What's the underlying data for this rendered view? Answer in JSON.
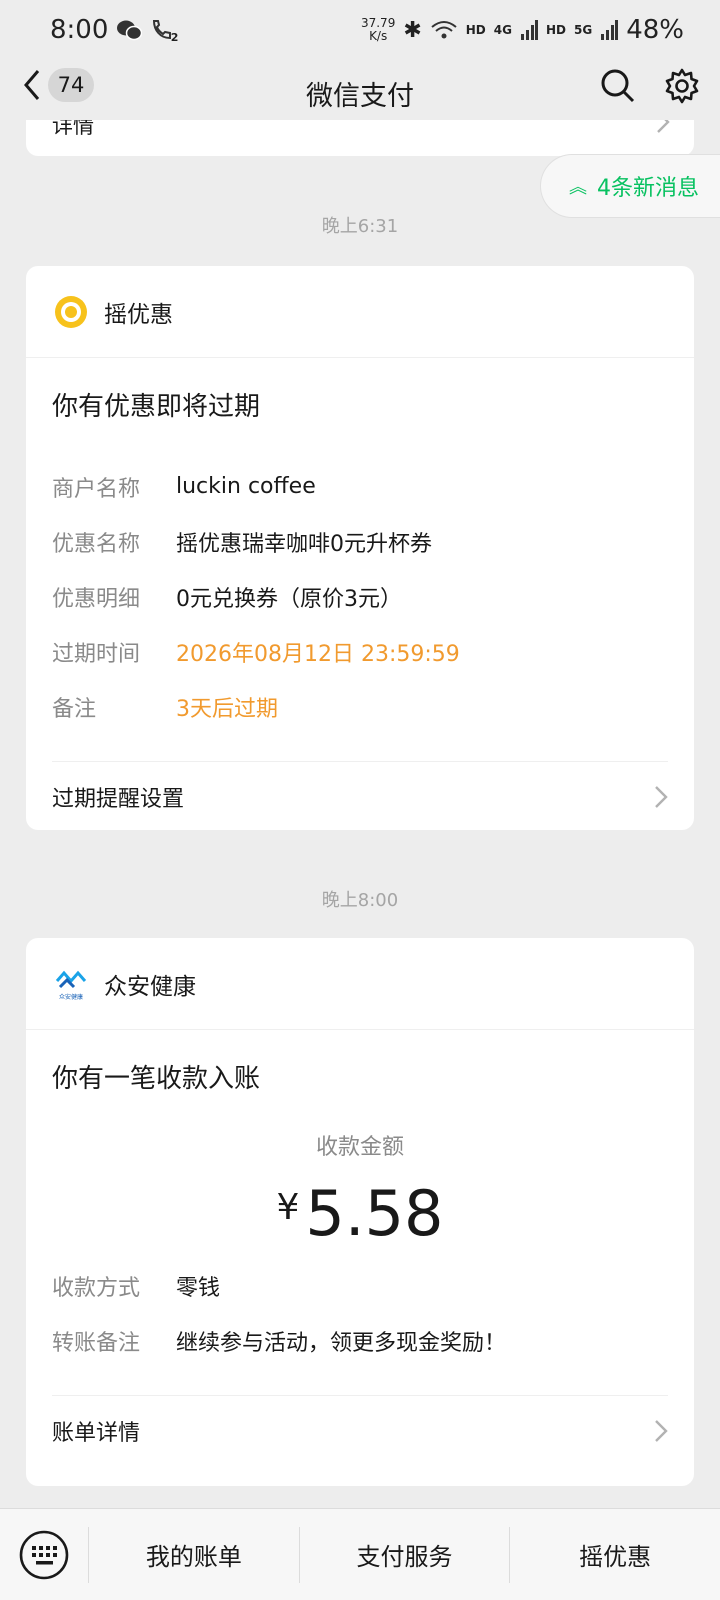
{
  "status": {
    "time": "8:00",
    "speed_value": "37.79",
    "speed_unit": "K/s",
    "hd1": "HD",
    "net1": "4G",
    "hd2": "HD",
    "net2": "5G",
    "battery": "48%",
    "sim_badge": "2"
  },
  "nav": {
    "badge": "74",
    "title": "微信支付"
  },
  "partial_card": {
    "text": "详情"
  },
  "new_messages": "4条新消息",
  "time1": "晚上6:31",
  "card1": {
    "brand": "摇优惠",
    "title": "你有优惠即将过期",
    "rows": [
      {
        "k": "商户名称",
        "v": "luckin coffee"
      },
      {
        "k": "优惠名称",
        "v": "摇优惠瑞幸咖啡0元升杯券"
      },
      {
        "k": "优惠明细",
        "v": "0元兑换券（原价3元）"
      },
      {
        "k": "过期时间",
        "v": "2026年08月12日 23:59:59"
      },
      {
        "k": "备注",
        "v": "3天后过期"
      }
    ],
    "footer": "过期提醒设置"
  },
  "time2": "晚上8:00",
  "card2": {
    "brand": "众安健康",
    "logo_text": "众安健康",
    "title": "你有一笔收款入账",
    "amount_label": "收款金额",
    "currency": "¥",
    "amount": "5.58",
    "rows": [
      {
        "k": "收款方式",
        "v": "零钱"
      },
      {
        "k": "转账备注",
        "v": "继续参与活动，领更多现金奖励！"
      }
    ],
    "footer": "账单详情"
  },
  "bottom": {
    "tabs": [
      "我的账单",
      "支付服务",
      "摇优惠"
    ]
  },
  "colors": {
    "accent_green": "#07c160",
    "warning_orange": "#f19a2e"
  }
}
